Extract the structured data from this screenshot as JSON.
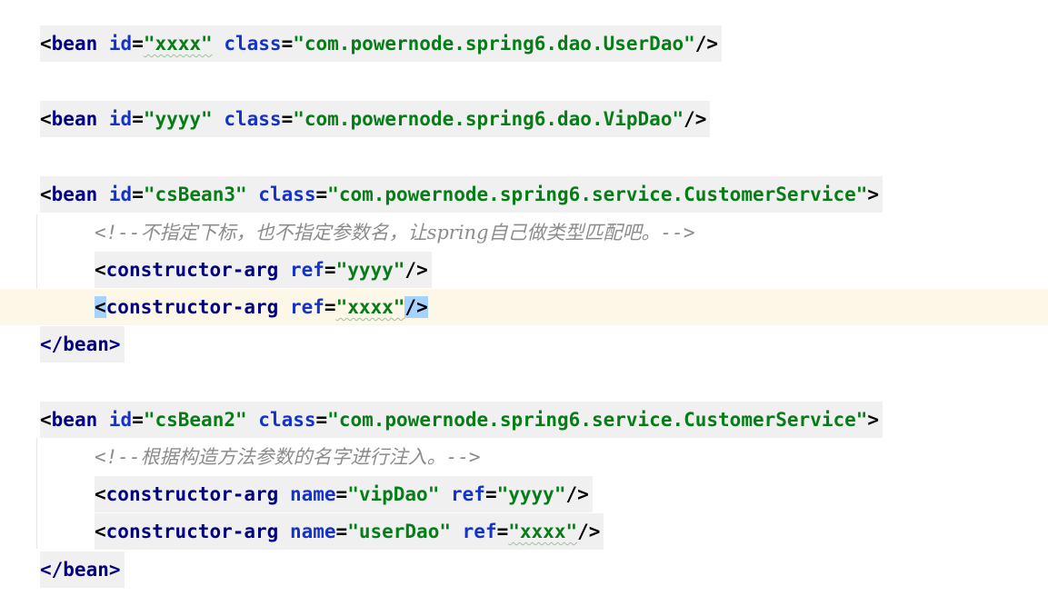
{
  "lines": {
    "l1": {
      "open": "<",
      "tag": "bean",
      "a1": "id",
      "eq1": "=",
      "v1": "\"xxxx\"",
      "a2": "class",
      "eq2": "=",
      "v2": "\"com.powernode.spring6.dao.UserDao\"",
      "close": "/>"
    },
    "l2": {
      "open": "<",
      "tag": "bean",
      "a1": "id",
      "eq1": "=",
      "v1": "\"yyyy\"",
      "a2": "class",
      "eq2": "=",
      "v2": "\"com.powernode.spring6.dao.VipDao\"",
      "close": "/>"
    },
    "l3": {
      "open": "<",
      "tag": "bean",
      "a1": "id",
      "eq1": "=",
      "v1": "\"csBean3\"",
      "a2": "class",
      "eq2": "=",
      "v2": "\"com.powernode.spring6.service.CustomerService\"",
      "close": ">"
    },
    "l4": {
      "comment_open": "<!--",
      "comment_text": "不指定下标，也不指定参数名，让spring自己做类型匹配吧。",
      "comment_close": "-->"
    },
    "l5": {
      "open": "<",
      "tag": "constructor-arg",
      "a1": "ref",
      "eq1": "=",
      "v1": "\"yyyy\"",
      "close": "/>"
    },
    "l6": {
      "open": "<",
      "tag": "constructor-arg",
      "a1": "ref",
      "eq1": "=",
      "v1": "\"xxxx\"",
      "close": "/>"
    },
    "l7": {
      "text": "</bean>"
    },
    "l8": {
      "open": "<",
      "tag": "bean",
      "a1": "id",
      "eq1": "=",
      "v1": "\"csBean2\"",
      "a2": "class",
      "eq2": "=",
      "v2": "\"com.powernode.spring6.service.CustomerService\"",
      "close": ">"
    },
    "l9": {
      "comment_open": "<!--",
      "comment_text": "根据构造方法参数的名字进行注入。",
      "comment_close": "-->"
    },
    "l10": {
      "open": "<",
      "tag": "constructor-arg",
      "a1": "name",
      "eq1": "=",
      "v1": "\"vipDao\"",
      "a2": "ref",
      "eq2": "=",
      "v2": "\"yyyy\"",
      "close": "/>"
    },
    "l11": {
      "open": "<",
      "tag": "constructor-arg",
      "a1": "name",
      "eq1": "=",
      "v1": "\"userDao\"",
      "a2": "ref",
      "eq2": "=",
      "v2": "\"xxxx\"",
      "close": "/>"
    },
    "l12": {
      "text": "</bean>"
    }
  },
  "colors": {
    "tag": "#000080",
    "attribute": "#1533cc",
    "value": "#067d17",
    "comment": "#8c8c8c",
    "current_line": "#fcf7e6",
    "selection": "#a6d2ff"
  }
}
